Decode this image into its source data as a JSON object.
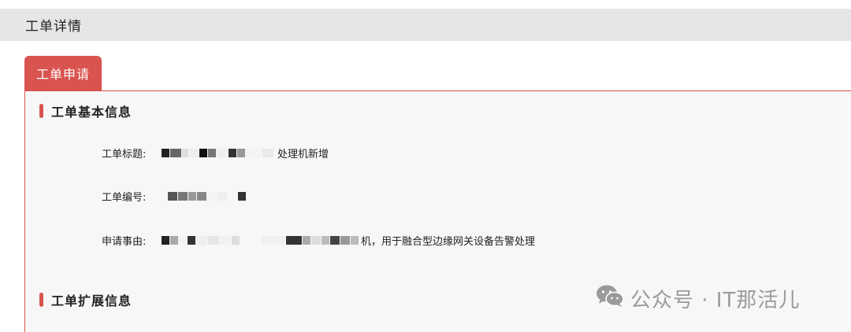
{
  "header": {
    "title": "工单详情"
  },
  "tabs": [
    {
      "label": "工单申请"
    }
  ],
  "sections": {
    "basic": {
      "title": "工单基本信息",
      "fields": {
        "title_label": "工单标题:",
        "title_value_visible": "处理机新增",
        "number_label": "工单编号:",
        "reason_label": "申请事由:",
        "reason_value_visible": "机，用于融合型边缘网关设备告警处理"
      }
    },
    "extended": {
      "title": "工单扩展信息"
    }
  },
  "watermark": {
    "text": "公众号 · IT那活儿",
    "icon": "wechat-icon"
  },
  "colors": {
    "accent": "#d9534f",
    "header_bg": "#e6e6e6",
    "panel_bg": "#f7f7f7"
  }
}
